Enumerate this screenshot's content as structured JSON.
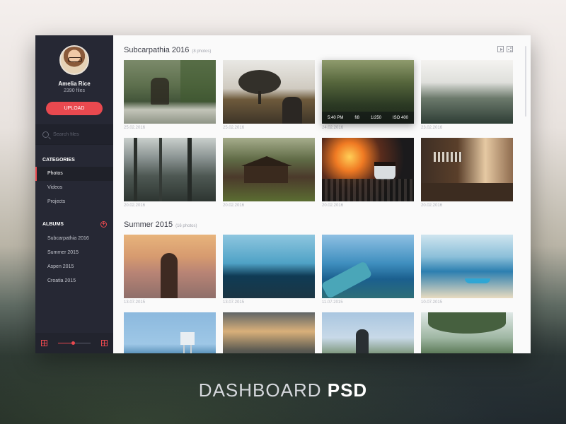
{
  "sidebar": {
    "user": {
      "name": "Amelia Rice",
      "files": "2390 files"
    },
    "upload_label": "UPLOAD",
    "search_placeholder": "Search files",
    "categories_title": "CATEGORIES",
    "categories": [
      {
        "label": "Photos",
        "active": true
      },
      {
        "label": "Videos",
        "active": false
      },
      {
        "label": "Projects",
        "active": false
      }
    ],
    "albums_title": "ALBUMS",
    "albums": [
      {
        "label": "Subcarpathia 2016"
      },
      {
        "label": "Summer 2015"
      },
      {
        "label": "Aspen 2015"
      },
      {
        "label": "Croatia 2015"
      }
    ],
    "zoom_level": 0.45
  },
  "main": {
    "albums": [
      {
        "title": "Subcarpathia 2016",
        "count": "(8 photos)",
        "photos": [
          {
            "date": "25.02.2016",
            "style": "p-deer"
          },
          {
            "date": "25.02.2016",
            "style": "p-tree"
          },
          {
            "date": "24.02.2016",
            "style": "p-fog",
            "selected": true
          },
          {
            "date": "23.02.2016",
            "style": "p-mist"
          },
          {
            "date": "20.02.2016",
            "style": "p-wood"
          },
          {
            "date": "20.02.2016",
            "style": "p-cabin"
          },
          {
            "date": "20.02.2016",
            "style": "p-fire"
          },
          {
            "date": "20.02.2016",
            "style": "p-kitch"
          }
        ]
      },
      {
        "title": "Summer 2015",
        "count": "(16 photos)",
        "photos": [
          {
            "date": "13.07.2015",
            "style": "p-girl"
          },
          {
            "date": "13.07.2015",
            "style": "p-beach1"
          },
          {
            "date": "11.07.2015",
            "style": "p-hand"
          },
          {
            "date": "10.07.2015",
            "style": "p-boat"
          },
          {
            "date": "",
            "style": "p-tower"
          },
          {
            "date": "",
            "style": "p-sunset"
          },
          {
            "date": "",
            "style": "p-city"
          },
          {
            "date": "",
            "style": "p-swing"
          }
        ]
      }
    ],
    "exif": {
      "shutter_time": "5:40 PM",
      "aperture": "f/8",
      "speed": "1/250",
      "iso": "ISO 400"
    }
  },
  "footer": {
    "title_light": "DASHBOARD",
    "title_bold": "PSD"
  },
  "colors": {
    "accent": "#e9494f",
    "sidebar_bg": "#262834"
  },
  "icons": [
    "search-icon",
    "add-icon",
    "grid-icon",
    "play-icon",
    "share-icon"
  ]
}
